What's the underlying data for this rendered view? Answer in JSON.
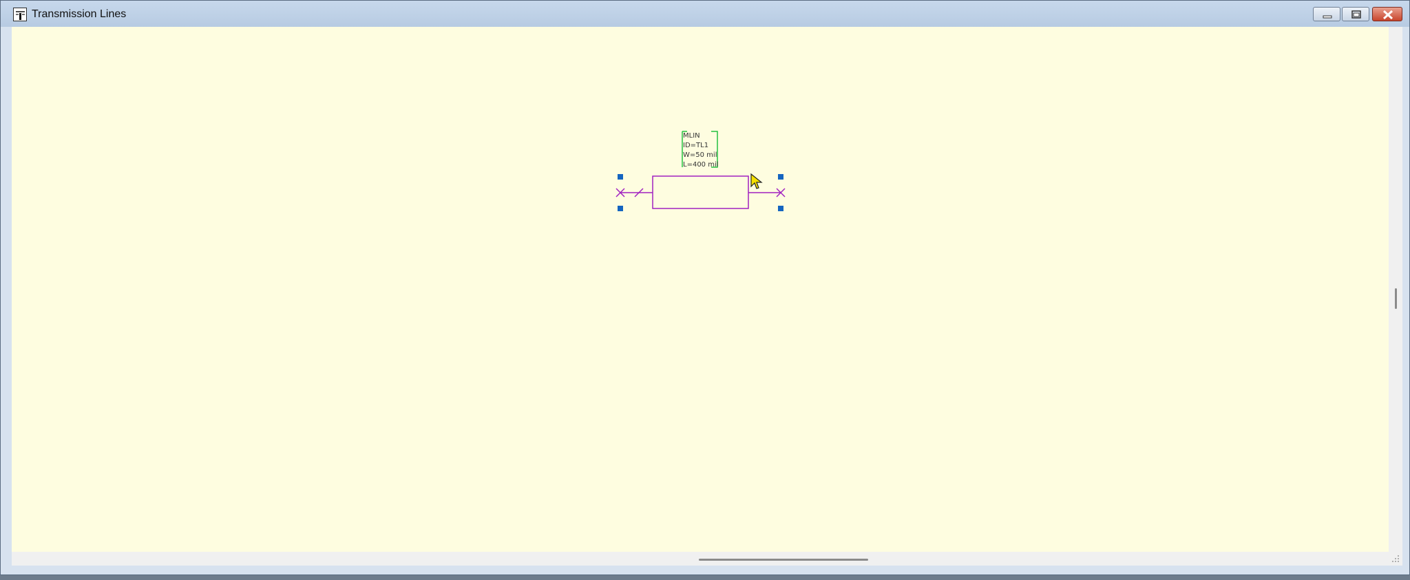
{
  "window": {
    "title": "Transmission Lines",
    "icon": "schematic-app-icon"
  },
  "caption_buttons": {
    "minimize": "minimize-icon",
    "maximize": "restore-icon",
    "close": "close-icon"
  },
  "component": {
    "type": "MLIN",
    "id": "ID=TL1",
    "width": "W=50 mil",
    "length": "L=400 mil"
  },
  "colors": {
    "canvas_background": "#fefde0",
    "component_wire": "#a020c0",
    "label_box": "#22c040",
    "selection_handles": "#1565c0"
  }
}
